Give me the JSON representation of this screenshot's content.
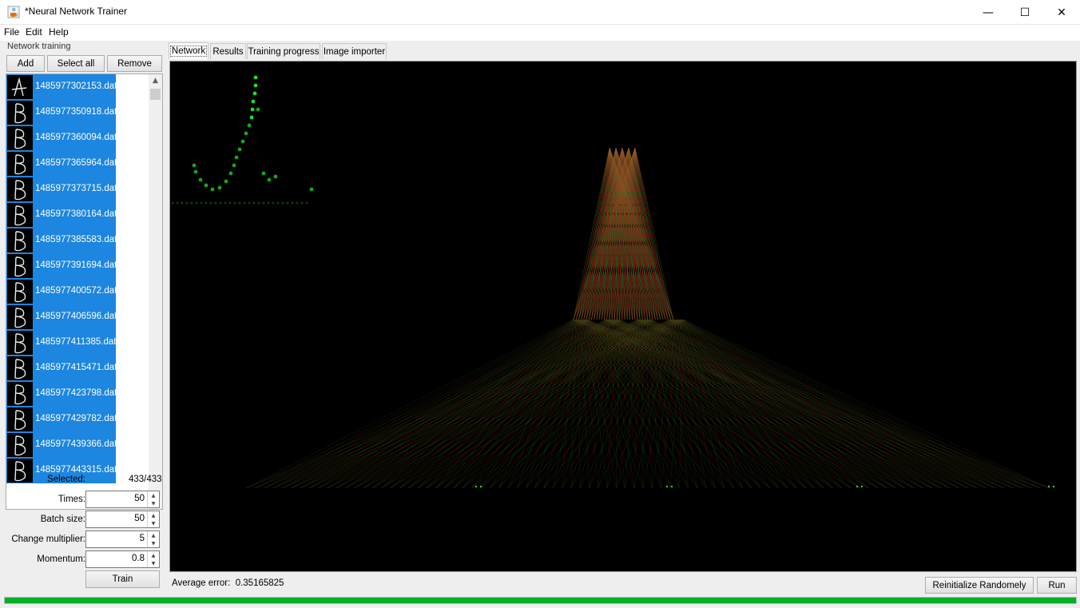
{
  "window": {
    "title": "*Neural Network Trainer",
    "minimize_glyph": "—",
    "maximize_glyph": "☐",
    "close_glyph": "✕"
  },
  "menu": {
    "items": [
      "File",
      "Edit",
      "Help"
    ]
  },
  "left_panel": {
    "group_title": "Network training",
    "buttons": {
      "add": "Add",
      "select_all": "Select all",
      "remove": "Remove"
    },
    "files": [
      {
        "name": "1485977302153.dat",
        "glyph": "A"
      },
      {
        "name": "1485977350918.dat",
        "glyph": "B"
      },
      {
        "name": "1485977360094.dat",
        "glyph": "B"
      },
      {
        "name": "1485977365964.dat",
        "glyph": "B"
      },
      {
        "name": "1485977373715.dat",
        "glyph": "B"
      },
      {
        "name": "1485977380164.dat",
        "glyph": "B"
      },
      {
        "name": "1485977385583.dat",
        "glyph": "B"
      },
      {
        "name": "1485977391694.dat",
        "glyph": "B"
      },
      {
        "name": "1485977400572.dat",
        "glyph": "B"
      },
      {
        "name": "1485977406596.dat",
        "glyph": "B"
      },
      {
        "name": "1485977411385.dat",
        "glyph": "B"
      },
      {
        "name": "1485977415471.dat",
        "glyph": "B"
      },
      {
        "name": "1485977423798.dat",
        "glyph": "B"
      },
      {
        "name": "1485977429782.dat",
        "glyph": "B"
      },
      {
        "name": "1485977439366.dat",
        "glyph": "B"
      },
      {
        "name": "1485977443315.dat",
        "glyph": "B"
      }
    ],
    "selected_label": "Selected:",
    "selected_value": "433/433",
    "params": {
      "times_label": "Times:",
      "times_value": "50",
      "batch_label": "Batch size:",
      "batch_value": "50",
      "change_label": "Change multiplier:",
      "change_value": "5",
      "momentum_label": "Momentum:",
      "momentum_value": "0.8"
    },
    "train_button": "Train"
  },
  "tabs": [
    "Network",
    "Results",
    "Training progress",
    "Image importer"
  ],
  "status": {
    "average_error_label": "Average error:",
    "average_error_value": "0.35165825"
  },
  "bottom_buttons": {
    "reinitialize": "Reinitialize Randomely",
    "run": "Run"
  },
  "progress": {
    "fraction": 1.0
  },
  "colors": {
    "selection": "#1c86e0",
    "progress": "#06b025",
    "neuron": "#22dd22",
    "weight_pos": "#cc3322",
    "weight_neg": "#22aa33"
  },
  "icons": {
    "app": "java-cup-icon",
    "scroll_up": "scroll-up-icon",
    "scroll_down": "scroll-down-icon"
  }
}
